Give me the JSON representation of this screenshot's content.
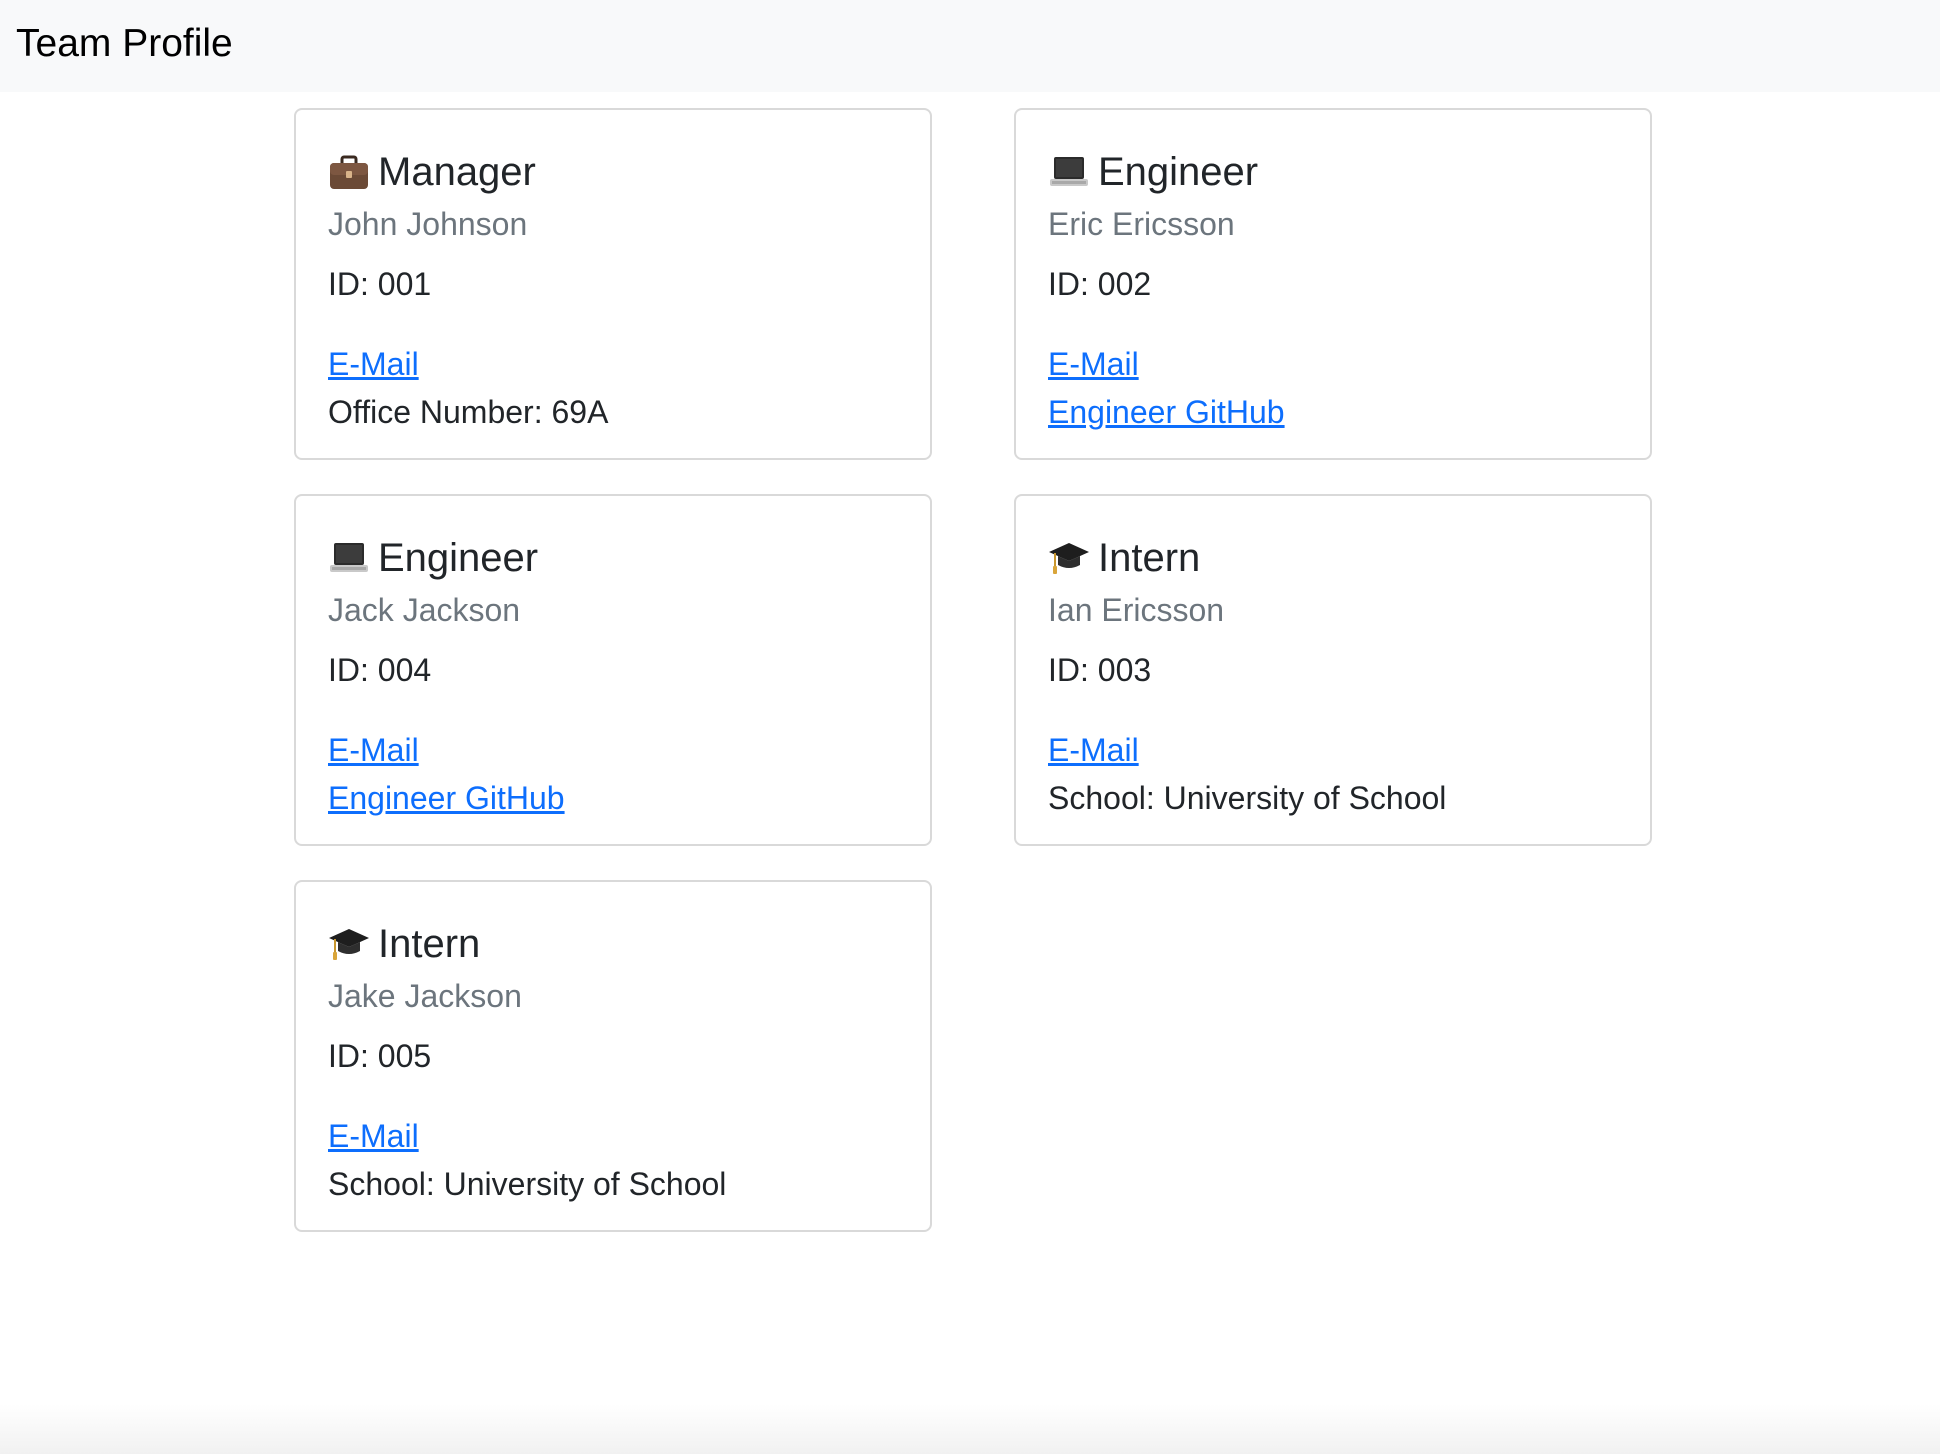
{
  "navbar": {
    "brand": "Team Profile"
  },
  "cards": [
    {
      "role": "Manager",
      "role_icon": "briefcase-icon",
      "name": "John Johnson",
      "id_text": "ID: 001",
      "email_label": "E-Mail",
      "extra_type": "text",
      "extra": "Office Number: 69A"
    },
    {
      "role": "Engineer",
      "role_icon": "laptop-icon",
      "name": "Eric Ericsson",
      "id_text": "ID: 002",
      "email_label": "E-Mail",
      "extra_type": "link",
      "extra": "Engineer GitHub"
    },
    {
      "role": "Engineer",
      "role_icon": "laptop-icon",
      "name": "Jack Jackson",
      "id_text": "ID: 004",
      "email_label": "E-Mail",
      "extra_type": "link",
      "extra": "Engineer GitHub"
    },
    {
      "role": "Intern",
      "role_icon": "graduation-cap-icon",
      "name": "Ian Ericsson",
      "id_text": "ID: 003",
      "email_label": "E-Mail",
      "extra_type": "text",
      "extra": "School: University of School"
    },
    {
      "role": "Intern",
      "role_icon": "graduation-cap-icon",
      "name": "Jake Jackson",
      "id_text": "ID: 005",
      "email_label": "E-Mail",
      "extra_type": "text",
      "extra": "School: University of School"
    }
  ],
  "colors": {
    "link": "#0d6efd",
    "muted": "#6c757d",
    "navbar_bg": "#f8f9fa",
    "card_border": "#d9d9d9"
  }
}
